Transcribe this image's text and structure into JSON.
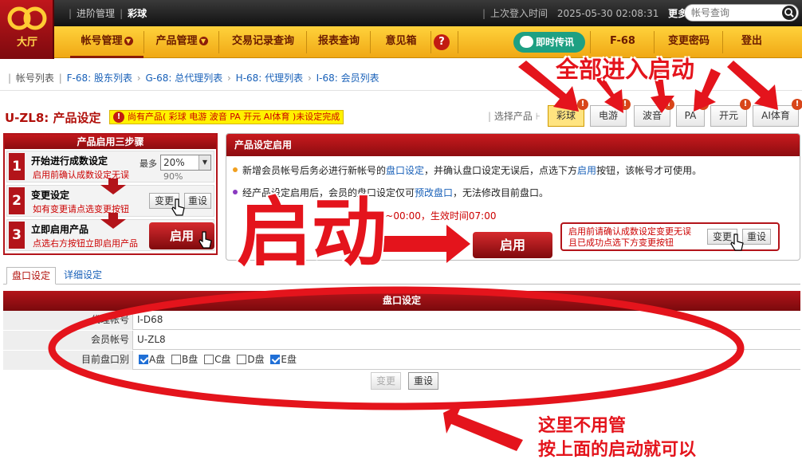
{
  "app": {
    "logo_label": "大厅"
  },
  "topnav": {
    "items": [
      "进阶管理",
      "彩球"
    ],
    "last_login_label": "上次登入时间",
    "last_login_time": "2025-05-30 02:08:31",
    "more": "更多"
  },
  "search": {
    "placeholder": "帐号查询"
  },
  "menu": {
    "items": [
      "帐号管理",
      "产品管理",
      "交易记录查询",
      "报表查询",
      "意见箱"
    ],
    "help": "?",
    "chat": "即时传讯",
    "account": "F-68",
    "change_password": "变更密码",
    "logout": "登出"
  },
  "breadcrumb": {
    "label": "帐号列表",
    "links": [
      "F-68: 股东列表",
      "G-68: 总代理列表",
      "H-68: 代理列表",
      "I-68: 会员列表"
    ]
  },
  "page": {
    "title": "U-ZL8: 产品设定",
    "warning": "尚有产品( 彩球 电游 波音 PA 开元 AI体育 )未设定完成",
    "select_label": "选择产品",
    "products": [
      "彩球",
      "电游",
      "波音",
      "PA",
      "开元",
      "AI体育"
    ],
    "badge": "!"
  },
  "steps": {
    "title": "产品启用三步骤",
    "items": [
      {
        "num": "1",
        "title": "开始进行成数设定",
        "desc": "启用前确认成数设定无误",
        "max": "最多",
        "percent": "20%",
        "percent_next": "90%"
      },
      {
        "num": "2",
        "title": "变更设定",
        "desc": "如有变更请点选变更按钮",
        "change": "变更",
        "reset": "重设"
      },
      {
        "num": "3",
        "title": "立即启用产品",
        "desc": "点选右方按钮立即启用产品",
        "enable": "启用"
      }
    ]
  },
  "enable_panel": {
    "title": "产品设定启用",
    "line1_a": "新增会员帐号后务必进行新帐号的",
    "line1_link": "盘口设定",
    "line1_b": "，并确认盘口设定无误后，点选下方",
    "line1_link2": "启用",
    "line1_c": "按钮，该帐号才可使用。",
    "line2_a": "经产品设定启用后，会员的盘口设定仅可",
    "line2_link": "预改盘口",
    "line2_b": "，无法修改目前盘口。",
    "line3": "00~00:00，生效时间07:00",
    "enable": "启用",
    "note1": "启用前请确认成数设定变更无误",
    "note2": "且已成功点选下方变更按钮",
    "change": "变更",
    "reset": "重设"
  },
  "tabs": [
    "盘口设定",
    "详细设定"
  ],
  "form": {
    "header": "盘口设定",
    "rows": [
      {
        "label": "代理帐号",
        "value": "I-D68"
      },
      {
        "label": "会员帐号",
        "value": "U-ZL8"
      },
      {
        "label": "目前盘口别"
      }
    ],
    "options": [
      {
        "label": "A盘",
        "checked": true
      },
      {
        "label": "B盘",
        "checked": false
      },
      {
        "label": "C盘",
        "checked": false
      },
      {
        "label": "D盘",
        "checked": false
      },
      {
        "label": "E盘",
        "checked": true
      }
    ],
    "change": "变更",
    "reset": "重设"
  },
  "annotations": {
    "all_enable": "全部进入启动",
    "big": "启动",
    "note_line1": "这里不用管",
    "note_line2": "按上面的启动就可以"
  },
  "colors": {
    "brand_red": "#b3141a",
    "menu_gold": "#f0a814",
    "annotation_red": "#e4141c",
    "link_blue": "#1860b8"
  }
}
